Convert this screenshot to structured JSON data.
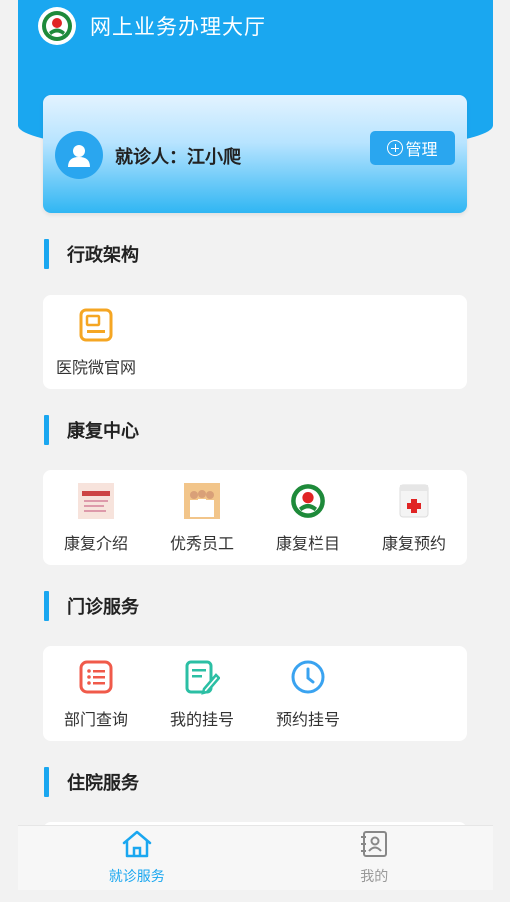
{
  "header": {
    "title": "网上业务办理大厅",
    "accent_color": "#1aa7f0"
  },
  "patient": {
    "label": "就诊人：江小爬",
    "manage_label": "管理"
  },
  "sections": {
    "admin": {
      "title": "行政架构",
      "items": [
        {
          "label": "医院微官网",
          "icon": "document-icon"
        }
      ]
    },
    "rehab": {
      "title": "康复中心",
      "items": [
        {
          "label": "康复介绍",
          "icon": "rehab-intro-thumbnail"
        },
        {
          "label": "优秀员工",
          "icon": "staff-thumbnail"
        },
        {
          "label": "康复栏目",
          "icon": "hospital-logo-icon"
        },
        {
          "label": "康复预约",
          "icon": "medical-kit-icon"
        }
      ]
    },
    "outpatient": {
      "title": "门诊服务",
      "items": [
        {
          "label": "部门查询",
          "icon": "list-icon"
        },
        {
          "label": "我的挂号",
          "icon": "edit-note-icon"
        },
        {
          "label": "预约挂号",
          "icon": "clock-icon"
        }
      ]
    },
    "inpatient": {
      "title": "住院服务"
    }
  },
  "tabbar": {
    "items": [
      {
        "label": "就诊服务",
        "icon": "home-icon",
        "active": true
      },
      {
        "label": "我的",
        "icon": "contact-book-icon",
        "active": false
      }
    ]
  }
}
